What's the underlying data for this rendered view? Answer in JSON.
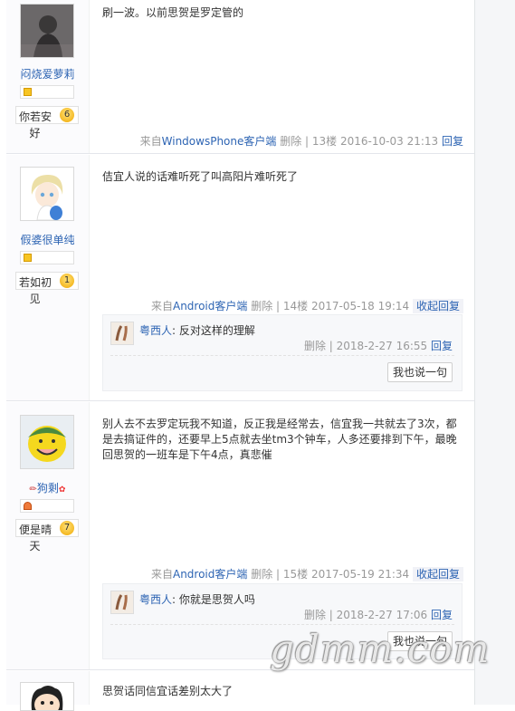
{
  "posts": [
    {
      "username": "闷烧爱萝莉",
      "badge_text": "你若安",
      "badge_wrap": "好",
      "badge_num": "6",
      "content": "刷一波。以前思贺是罗定管的",
      "meta": {
        "source": "来自",
        "client": "WindowsPhone客户端",
        "delete": "删除",
        "floor": "13楼",
        "time": "2016-10-03 21:13",
        "action": "回复"
      }
    },
    {
      "username": "假婆很单纯",
      "badge_text": "若如初",
      "badge_wrap": "见",
      "badge_num": "1",
      "content": "佶宜人说的话难听死了叫高阳片难听死了",
      "meta": {
        "source": "来自",
        "client": "Android客户端",
        "delete": "删除",
        "floor": "14楼",
        "time": "2017-05-18 19:14",
        "action": "收起回复"
      },
      "reply": {
        "name": "粤西人",
        "text": ": 反对这样的理解",
        "delete": "删除",
        "time": "2018-2-27 16:55",
        "action": "回复",
        "say_button": "我也说一句"
      }
    },
    {
      "username": "狗剩",
      "badge_text": "便是晴",
      "badge_wrap": "天",
      "badge_num": "7",
      "content": "别人去不去罗定玩我不知道，反正我是经常去，信宜我一共就去了3次，都是去搞证件的，还要早上5点就去坐tm3个钟车，人多还要排到下午，最晚回思贺的一班车是下午4点，真悲催",
      "meta": {
        "source": "来自",
        "client": "Android客户端",
        "delete": "删除",
        "floor": "15楼",
        "time": "2017-05-19 21:34",
        "action": "收起回复"
      },
      "reply": {
        "name": "粤西人",
        "text": ": 你就是思贺人吗",
        "delete": "删除",
        "time": "2018-2-27 17:06",
        "action": "回复",
        "say_button": "我也说一句"
      }
    },
    {
      "content": "思贺话同信宜话差别太大了"
    }
  ],
  "watermark": "gdmm.com"
}
